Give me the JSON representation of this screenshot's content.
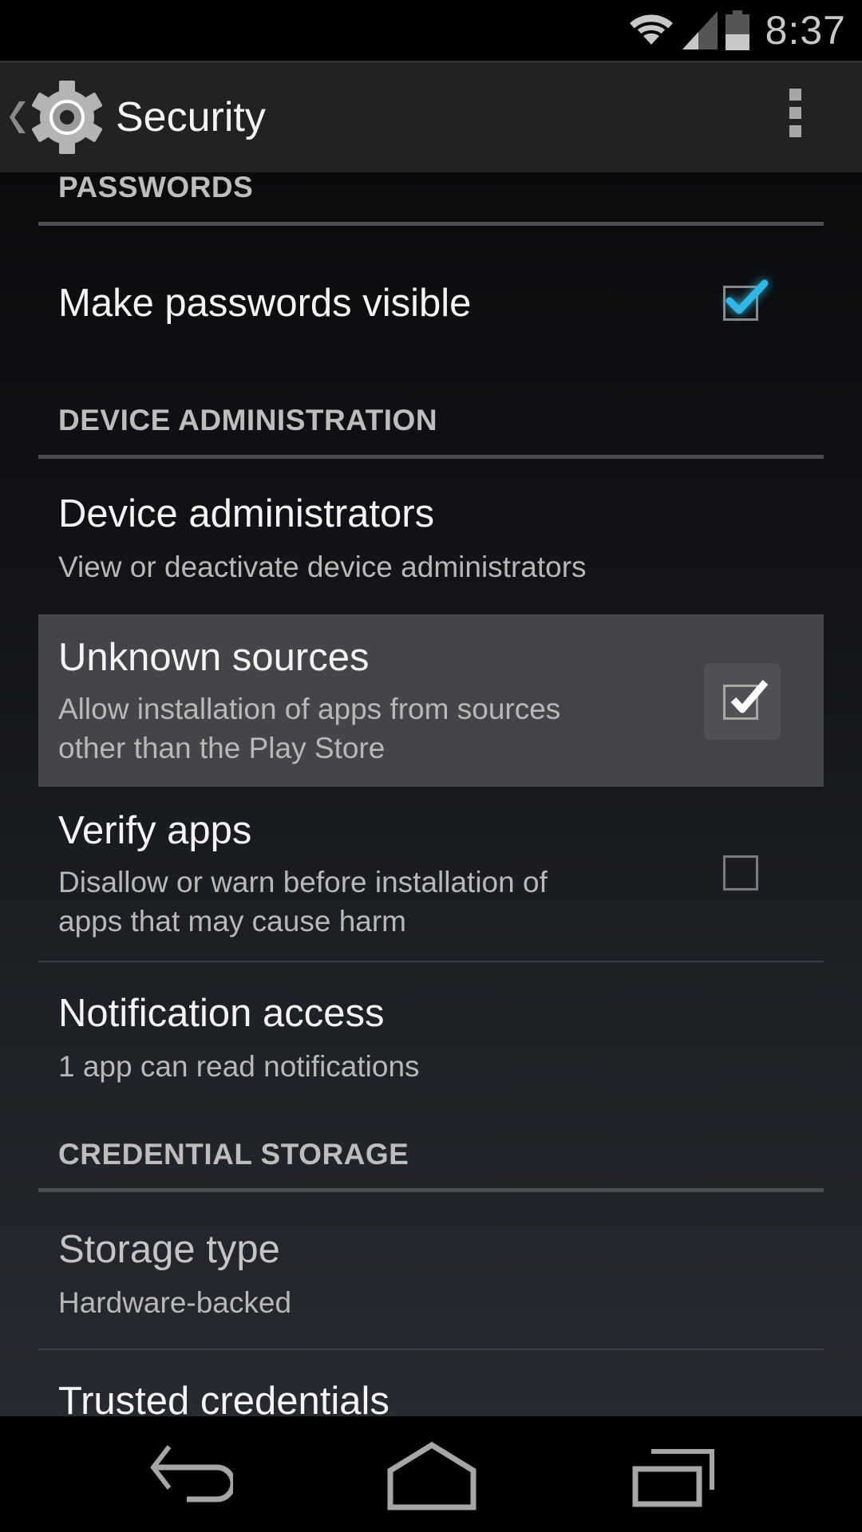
{
  "status_bar": {
    "time": "8:37",
    "icons": [
      "wifi-icon",
      "cell-signal-icon",
      "battery-icon"
    ],
    "battery_level": 0.45
  },
  "action_bar": {
    "title": "Security",
    "up_icon": "chevron-left-icon",
    "app_icon": "settings-gear-icon",
    "overflow_icon": "overflow-menu-icon"
  },
  "sections": {
    "passwords": {
      "header": "PASSWORDS",
      "items": [
        {
          "title": "Make passwords visible",
          "checked": true
        }
      ]
    },
    "device_admin": {
      "header": "DEVICE ADMINISTRATION",
      "items": [
        {
          "title": "Device administrators",
          "summary": "View or deactivate device administrators"
        },
        {
          "title": "Unknown sources",
          "summary_line1": "Allow installation of apps from sources",
          "summary_line2": "other than the Play Store",
          "checked": true,
          "pressed": true
        },
        {
          "title": "Verify apps",
          "summary_line1": "Disallow or warn before installation of",
          "summary_line2": "apps that may cause harm",
          "checked": false
        },
        {
          "title": "Notification access",
          "summary": "1 app can read notifications"
        }
      ]
    },
    "credential_storage": {
      "header": "CREDENTIAL STORAGE",
      "items": [
        {
          "title": "Storage type",
          "summary": "Hardware-backed",
          "disabled": true
        },
        {
          "title": "Trusted credentials"
        }
      ]
    }
  },
  "nav_bar": {
    "buttons": [
      "back-icon",
      "home-icon",
      "recents-icon"
    ]
  },
  "colors": {
    "accent": "#33b5e5",
    "action_bar": "#222222",
    "pressed": "#434548"
  }
}
